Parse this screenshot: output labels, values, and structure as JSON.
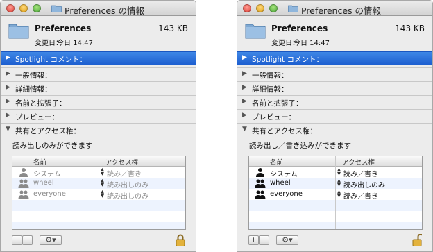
{
  "windows": [
    {
      "title": "Preferences の情報",
      "file": {
        "name": "Preferences",
        "size": "143 KB",
        "modified_label": "変更日：",
        "modified_value": "今日 14:47"
      },
      "sections": [
        {
          "label": "Spotlight コメント：",
          "active": true
        },
        {
          "label": "一般情報："
        },
        {
          "label": "詳細情報："
        },
        {
          "label": "名前と拡張子："
        },
        {
          "label": "プレビュー："
        },
        {
          "label": "共有とアクセス権：",
          "expanded": true
        }
      ],
      "sharing": {
        "permission_text": "読み出しのみができます",
        "columns": [
          "名前",
          "アクセス権"
        ],
        "rows": [
          {
            "name": "システム",
            "access": "読み／書き",
            "icon": "user-icon"
          },
          {
            "name": "wheel",
            "access": "読み出しのみ",
            "icon": "group-icon"
          },
          {
            "name": "everyone",
            "access": "読み出しのみ",
            "icon": "group-icon"
          }
        ],
        "locked": true,
        "disabled": true
      }
    },
    {
      "title": "Preferences の情報",
      "file": {
        "name": "Preferences",
        "size": "143 KB",
        "modified_label": "変更日：",
        "modified_value": "今日 14:47"
      },
      "sections": [
        {
          "label": "Spotlight コメント：",
          "active": true
        },
        {
          "label": "一般情報："
        },
        {
          "label": "詳細情報："
        },
        {
          "label": "名前と拡張子："
        },
        {
          "label": "プレビュー："
        },
        {
          "label": "共有とアクセス権：",
          "expanded": true
        }
      ],
      "sharing": {
        "permission_text": "読み出し／書き込みができます",
        "columns": [
          "名前",
          "アクセス権"
        ],
        "rows": [
          {
            "name": "システム",
            "access": "読み／書き",
            "icon": "user-icon"
          },
          {
            "name": "wheel",
            "access": "読み出しのみ",
            "icon": "group-icon"
          },
          {
            "name": "everyone",
            "access": "読み／書き",
            "icon": "group-icon"
          }
        ],
        "locked": false,
        "disabled": false
      }
    }
  ],
  "toolbar": {
    "add_label": "+",
    "remove_label": "−",
    "gear_label": "⚙▾"
  },
  "colors": {
    "accent": "#2a6ddb",
    "window_bg": "#ececec",
    "alt_row": "#edf3fe"
  }
}
